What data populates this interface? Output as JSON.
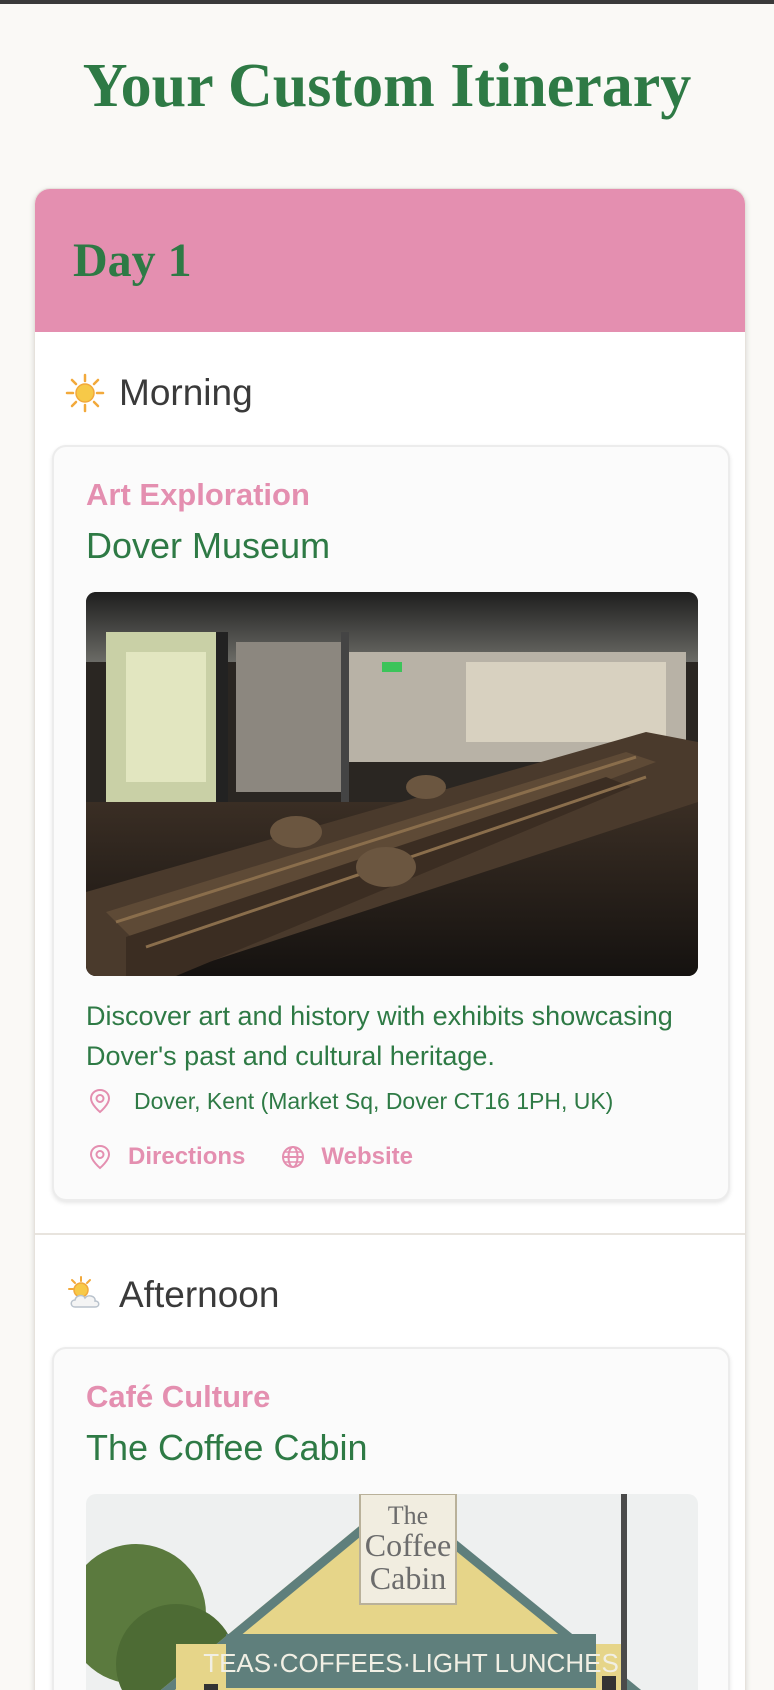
{
  "page": {
    "title": "Your Custom Itinerary"
  },
  "colors": {
    "accent_pink": "#e48fb0",
    "brand_green": "#2e7a45",
    "text_dark": "#3a3a3a"
  },
  "days": [
    {
      "title": "Day 1",
      "periods": [
        {
          "label": "Morning",
          "icon": "sun-icon",
          "activity": {
            "category": "Art Exploration",
            "name": "Dover Museum",
            "image": "museum-boat-exhibit-photo",
            "description": "Discover art and history with exhibits showcasing Dover's past and cultural heritage.",
            "address": "Dover, Kent (Market Sq, Dover CT16 1PH, UK)",
            "directions_label": "Directions",
            "website_label": "Website"
          }
        },
        {
          "label": "Afternoon",
          "icon": "sun-behind-cloud-icon",
          "activity": {
            "category": "Café Culture",
            "name": "The Coffee Cabin",
            "image": "coffee-cabin-storefront-photo",
            "sign_text": "TEAS · COFFEES · LIGHT LUNCHES",
            "logo_text": "The Coffee Cabin"
          }
        }
      ]
    }
  ]
}
